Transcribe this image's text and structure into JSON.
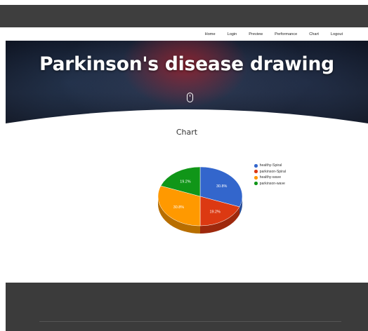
{
  "nav": {
    "items": [
      "Home",
      "Login",
      "Preview",
      "Performance",
      "Chart",
      "Logout"
    ]
  },
  "hero": {
    "title": "Parkinson's disease drawing",
    "scroll_icon": "mouse-scroll-icon"
  },
  "chart_section": {
    "heading": "Chart"
  },
  "chart_data": {
    "type": "pie",
    "categories": [
      "healthy-Spiral",
      "parkinson-Spiral",
      "healthy-wave",
      "parkinson-wave"
    ],
    "values": [
      30.8,
      19.2,
      30.8,
      19.2
    ],
    "labels": [
      "30.8%",
      "19.2%",
      "30.8%",
      "19.2%"
    ],
    "colors": [
      "#3366cc",
      "#dc3912",
      "#ff9900",
      "#109618"
    ],
    "legend_position": "right",
    "style": "3d"
  },
  "colors": {
    "top_bar": "#3e3e3e",
    "footer": "#3b3b3b",
    "hero_text": "#ffffff"
  }
}
